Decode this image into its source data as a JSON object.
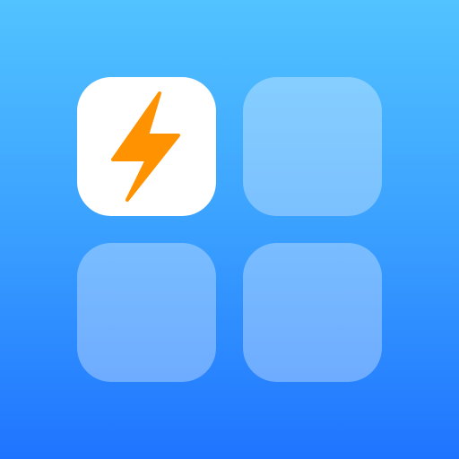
{
  "app_icon": {
    "icon_name": "bolt-grid-app-icon",
    "background_colors": [
      "#52C3FF",
      "#1F74FF"
    ],
    "tiles": [
      {
        "state": "active",
        "icon": "lightning-bolt-icon",
        "icon_color": "#FF9200",
        "fill": "#FFFFFF"
      },
      {
        "state": "empty",
        "fill": "rgba(255,255,255,0.33)"
      },
      {
        "state": "empty",
        "fill": "rgba(255,255,255,0.33)"
      },
      {
        "state": "empty",
        "fill": "rgba(255,255,255,0.33)"
      }
    ]
  }
}
